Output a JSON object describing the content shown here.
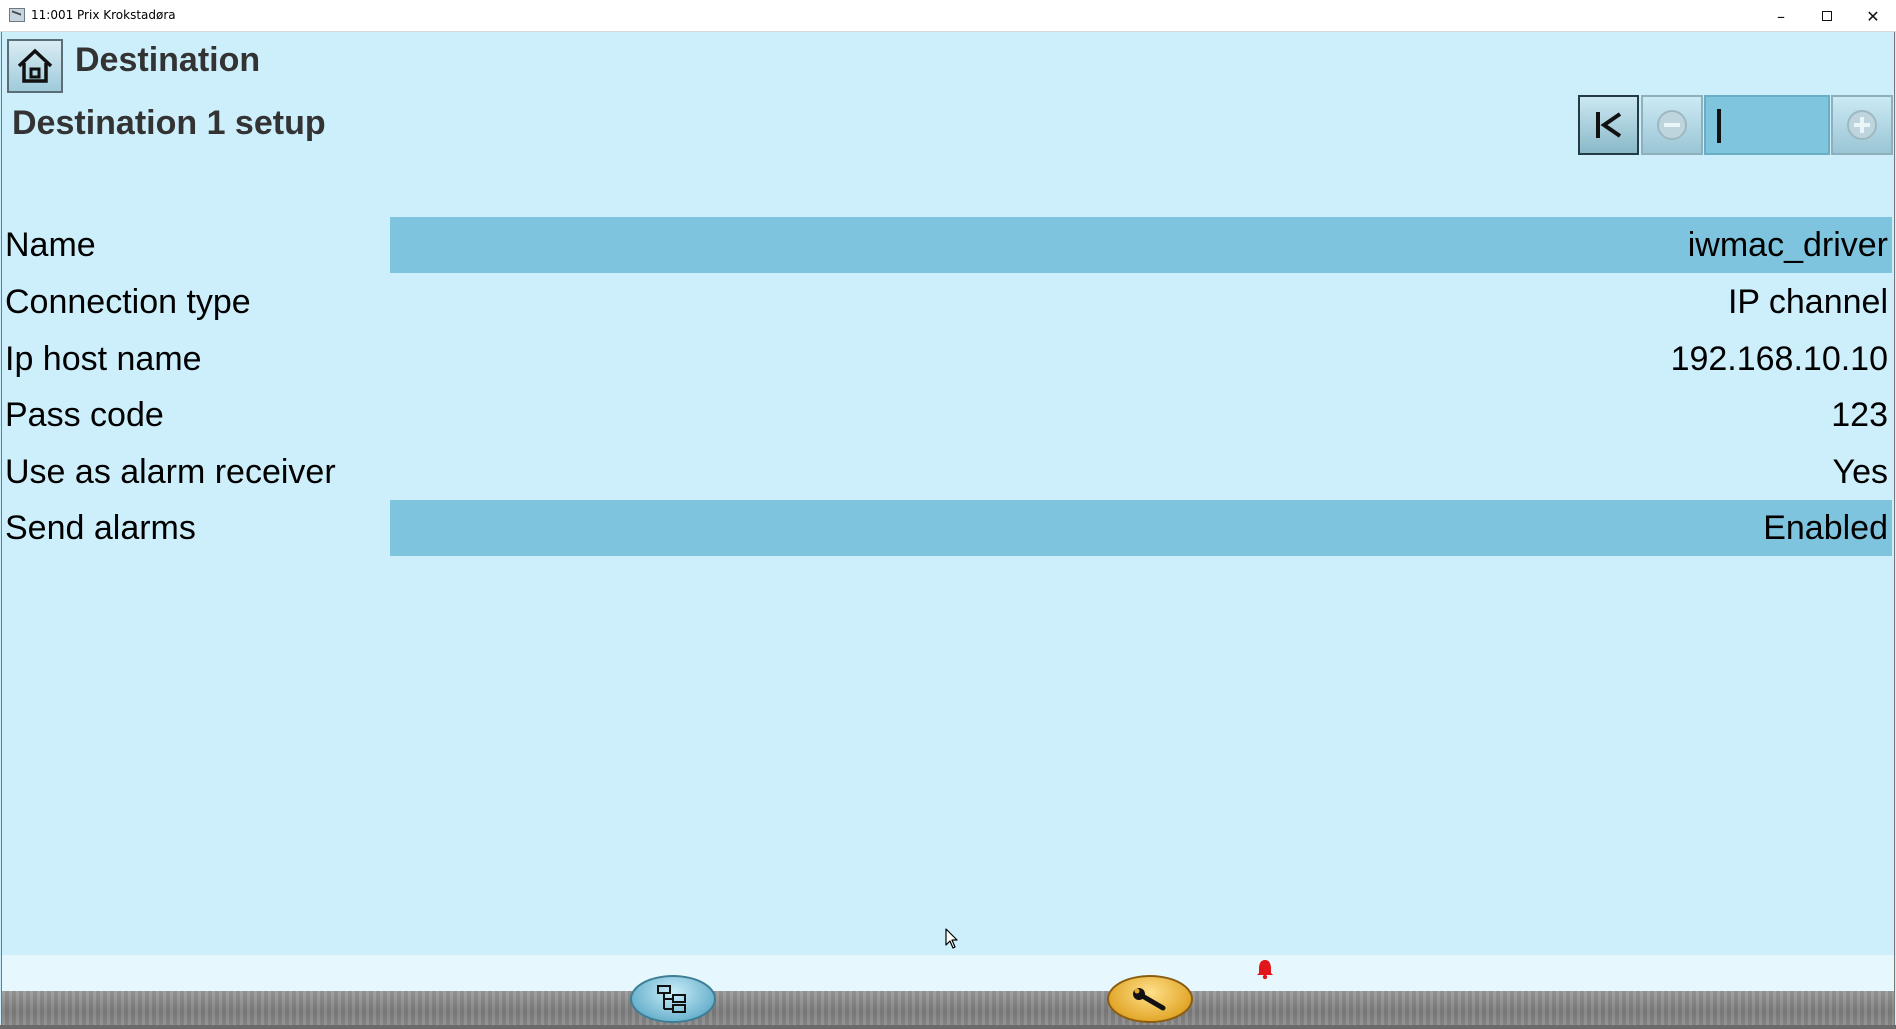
{
  "window": {
    "title": "11:001 Prix Krokstadøra",
    "controls": {
      "minimize": "–",
      "close": "✕"
    }
  },
  "header": {
    "title": "Destination",
    "subtitle": "Destination 1 setup"
  },
  "navigator": {
    "first_label": "|<",
    "prev_label": "-",
    "next_label": "+",
    "field_value": ""
  },
  "settings": [
    {
      "label": "Name",
      "value": "iwmac_driver",
      "selected": true
    },
    {
      "label": "Connection type",
      "value": "IP channel",
      "selected": false
    },
    {
      "label": "Ip host name",
      "value": "192.168.10.10",
      "selected": false
    },
    {
      "label": "Pass code",
      "value": "123",
      "selected": false
    },
    {
      "label": "Use as alarm receiver",
      "value": "Yes",
      "selected": false
    },
    {
      "label": "Send alarms",
      "value": "Enabled",
      "selected": true
    }
  ],
  "colors": {
    "background": "#cdeffb",
    "selected_row": "#7fc4de",
    "alarm": "#e0161b"
  },
  "icons": {
    "home": "home-icon",
    "tree": "tree-icon",
    "tool": "wrench-icon",
    "alarm": "alarm-bell-icon"
  }
}
